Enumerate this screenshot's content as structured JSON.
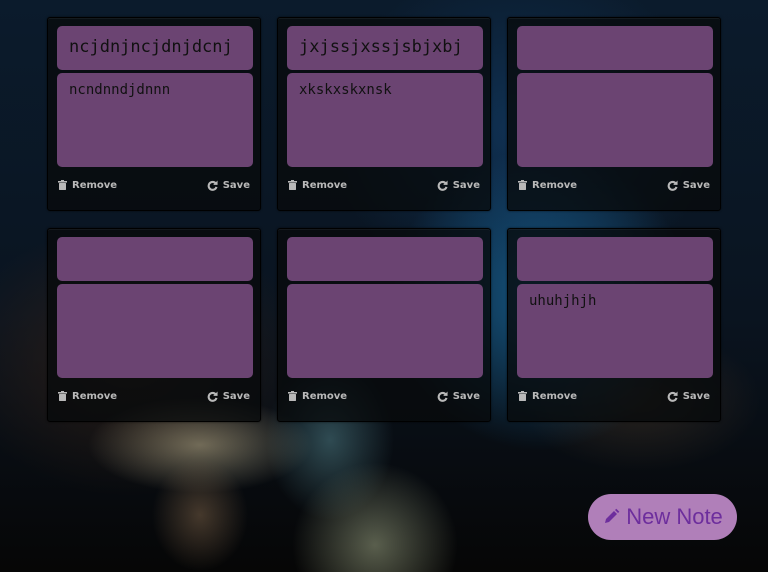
{
  "notes": [
    {
      "title": "ncjdnjncjdnjdcnj",
      "body": "ncndnndjdnnn",
      "remove_label": "Remove",
      "save_label": "Save"
    },
    {
      "title": "jxjssjxssjsbjxbj",
      "body": "xkskxskxnsk",
      "remove_label": "Remove",
      "save_label": "Save"
    },
    {
      "title": "",
      "body": "",
      "remove_label": "Remove",
      "save_label": "Save"
    },
    {
      "title": "",
      "body": "",
      "remove_label": "Remove",
      "save_label": "Save"
    },
    {
      "title": "",
      "body": "",
      "remove_label": "Remove",
      "save_label": "Save"
    },
    {
      "title": "",
      "body": "uhuhjhjh",
      "remove_label": "Remove",
      "save_label": "Save"
    }
  ],
  "new_note": {
    "label": "New Note",
    "icon": "pencil-icon"
  },
  "icons": {
    "remove": "trash-icon",
    "save": "refresh-icon"
  },
  "colors": {
    "note_field": "#6b4472",
    "card": "#0a0c0e",
    "new_note_bg": "#b07fb9",
    "new_note_text": "#6d2e9d",
    "action_text": "#b9b9b9"
  }
}
